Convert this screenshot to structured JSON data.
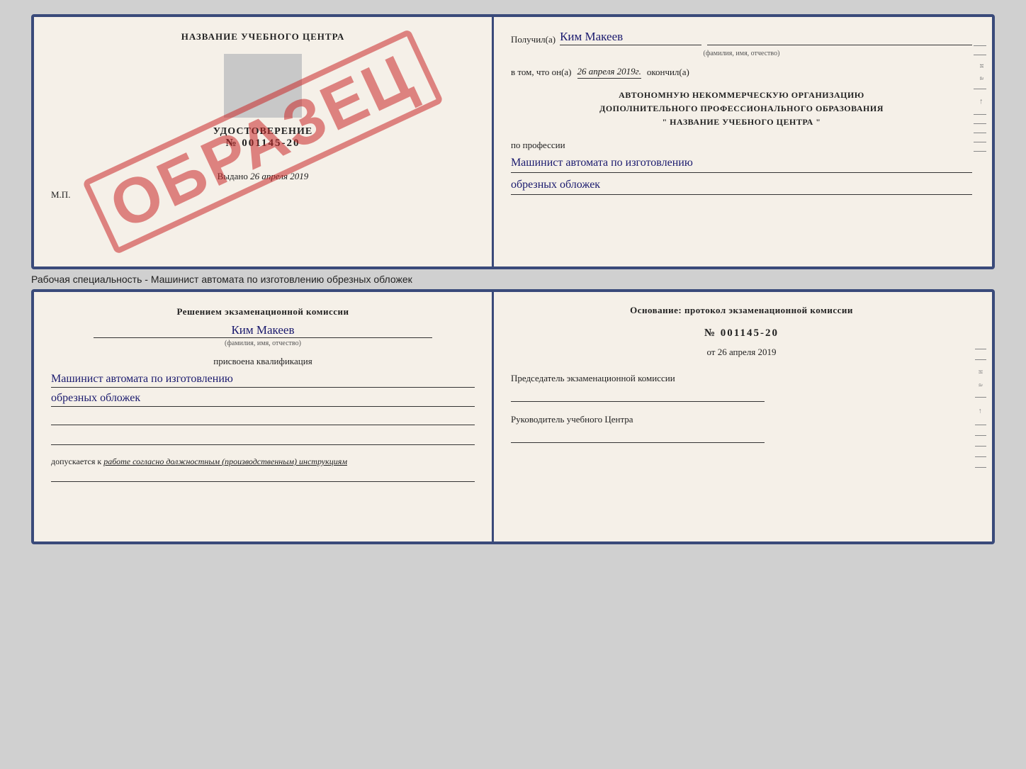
{
  "top_cert": {
    "left": {
      "center_title": "НАЗВАНИЕ УЧЕБНОГО ЦЕНТРА",
      "stamp_text": "ОБРАЗЕЦ",
      "udostoverenie_label": "УДОСТОВЕРЕНИЕ",
      "number": "№ 001145-20",
      "vydano_label": "Выдано",
      "vydano_date": "26 апреля 2019",
      "mp_label": "М.П."
    },
    "right": {
      "poluchil_label": "Получил(а)",
      "poluchil_name": "Ким Макеев",
      "fio_sub": "(фамилия, имя, отчество)",
      "vtom_label": "в том, что он(а)",
      "vtom_date": "26 апреля 2019г.",
      "okonchil_label": "окончил(а)",
      "org_line1": "АВТОНОМНУЮ НЕКОММЕРЧЕСКУЮ ОРГАНИЗАЦИЮ",
      "org_line2": "ДОПОЛНИТЕЛЬНОГО ПРОФЕССИОНАЛЬНОГО ОБРАЗОВАНИЯ",
      "org_line3": "\"  НАЗВАНИЕ УЧЕБНОГО ЦЕНТРА  \"",
      "po_professii_label": "по профессии",
      "profession_line1": "Машинист автомата по изготовлению",
      "profession_line2": "обрезных обложек"
    }
  },
  "specialty_label": "Рабочая специальность - Машинист автомата по изготовлению обрезных обложек",
  "bottom_cert": {
    "left": {
      "resheniem_label": "Решением экзаменационной комиссии",
      "komissia_name": "Ким Макеев",
      "fio_sub": "(фамилия, имя, отчество)",
      "prisvoena_label": "присвоена квалификация",
      "kvalif_line1": "Машинист автомата по изготовлению",
      "kvalif_line2": "обрезных обложек",
      "dopusk_prefix": "допускается к",
      "dopusk_text": "работе согласно должностным (производственным) инструкциям"
    },
    "right": {
      "osnovanie_label": "Основание: протокол экзаменационной комиссии",
      "protocol_number": "№  001145-20",
      "ot_prefix": "от",
      "ot_date": "26 апреля 2019",
      "predsedatel_label": "Председатель экзаменационной комиссии",
      "rukovoditel_label": "Руководитель учебного Центра"
    }
  },
  "side_labels": {
    "i": "и",
    "a": "а",
    "arrow": "←"
  }
}
